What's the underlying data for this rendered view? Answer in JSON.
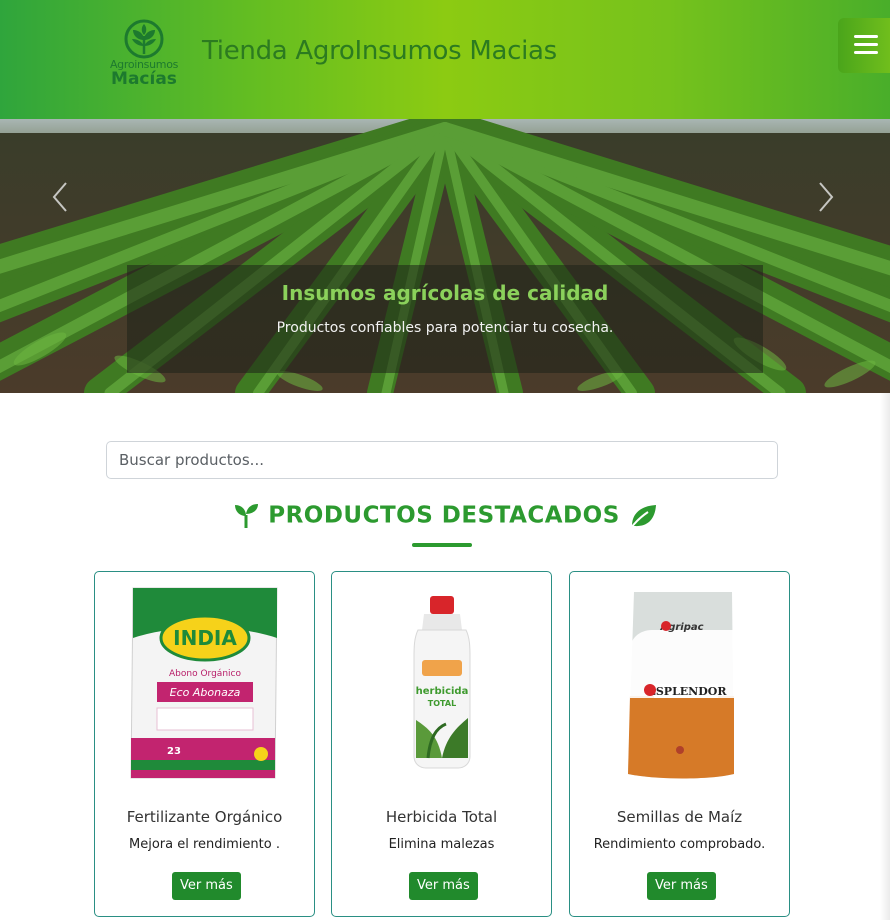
{
  "header": {
    "logo_line1": "Agroinsumos",
    "logo_line2": "Macías",
    "title": "Tienda AgroInsumos Macias",
    "menu_icon": "hamburger-icon"
  },
  "hero": {
    "title": "Insumos agrícolas de calidad",
    "subtitle": "Productos confiables para potenciar tu cosecha.",
    "prev_icon": "chevron-left-icon",
    "next_icon": "chevron-right-icon"
  },
  "search": {
    "placeholder": "Buscar productos...",
    "value": ""
  },
  "section": {
    "title": "PRODUCTOS DESTACADOS",
    "icon_left": "seedling-icon",
    "icon_right": "leaf-icon"
  },
  "products": [
    {
      "name": "Fertilizante Orgánico",
      "description": "Mejora el rendimiento .",
      "button": "Ver más",
      "package_brand": "INDIA",
      "package_line1": "Abono Orgánico",
      "package_line2": "Eco Abonaza",
      "package_weight": "23"
    },
    {
      "name": "Herbicida Total",
      "description": "Elimina malezas",
      "button": "Ver más",
      "package_line1": "herbicida",
      "package_line2": "TOTAL"
    },
    {
      "name": "Semillas de Maíz",
      "description": "Rendimiento comprobado.",
      "button": "Ver más",
      "package_brand": "Agripac",
      "package_line1": "ESPLENDOR"
    }
  ],
  "colors": {
    "brand_green": "#2c9a2f",
    "button_green": "#218a2c",
    "card_border": "#2a8f84",
    "header_lime": "#8ccb12"
  }
}
